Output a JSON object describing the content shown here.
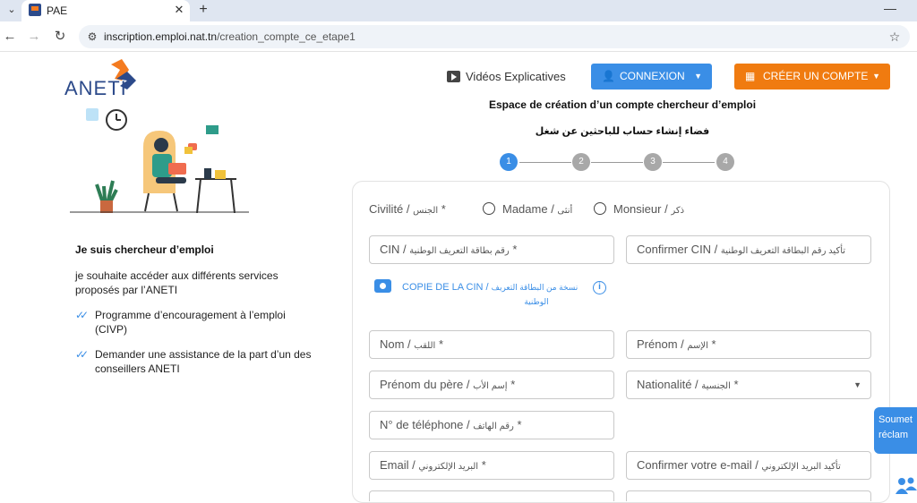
{
  "browser": {
    "tab_title": "PAE",
    "tab_close": "✕",
    "new_tab": "+",
    "minimize": "—",
    "url_domain": "inscription.emploi.nat.tn",
    "url_path": "/creation_compte_ce_etape1"
  },
  "header": {
    "logo_text": "ANETI",
    "videos_label": "Vidéos Explicatives",
    "connexion_label": "CONNEXION",
    "creer_label": "CRÉER UN COMPTE"
  },
  "left": {
    "title": "Je suis chercheur d’emploi",
    "description": "je souhaite accéder aux différents services proposés par l’ANETI",
    "items": [
      "Programme d’encouragement à l’emploi (CIVP)",
      "Demander une assistance de la part d’un des conseillers ANETI"
    ]
  },
  "form": {
    "title": "Espace de création d’un compte chercheur d’emploi",
    "title_ar": "فضاء إنشاء حساب للباحثين عن شغل",
    "steps": [
      "1",
      "2",
      "3",
      "4"
    ],
    "active_step": 1,
    "civilite_label": "Civilité / ",
    "civilite_ar": "الجنس",
    "civilite_star": " *",
    "madame": "Madame / ",
    "madame_ar": "أنثى",
    "monsieur": "Monsieur / ",
    "monsieur_ar": "ذكر",
    "cin_label": "CIN / ",
    "cin_ar": "رقم بطاقة التعريف الوطنية",
    "confirm_cin_label": "Confirmer CIN / ",
    "confirm_cin_ar": "تأكيد رقم البطاقة التعريف الوطنية",
    "copie_label": "COPIE DE LA CIN / ",
    "copie_ar": "نسخة من البطاقة التعريف",
    "copie_ar2": "الوطنية",
    "info_glyph": "i",
    "nom_label": "Nom / ",
    "nom_ar": "اللقب",
    "prenom_label": "Prénom / ",
    "prenom_ar": "الإسم",
    "prenom_pere_label": "Prénom du père / ",
    "prenom_pere_ar": "إسم الأب",
    "nationalite_label": "Nationalité / ",
    "nationalite_ar": "الجنسية",
    "telephone_label": "N° de téléphone / ",
    "telephone_ar": "رقم الهاتف",
    "email_label": "Email / ",
    "email_ar": "البريد الإلكتروني",
    "confirm_email_label": "Confirmer votre e-mail / ",
    "confirm_email_ar": "تأكيد البريد الإلكتروني",
    "star": "*"
  },
  "reclamation": {
    "line1": "Soumet",
    "line2": "réclam"
  },
  "colors": {
    "primary_blue": "#3a8ee6",
    "orange": "#f07b10",
    "brand_navy": "#2c4a8a"
  }
}
